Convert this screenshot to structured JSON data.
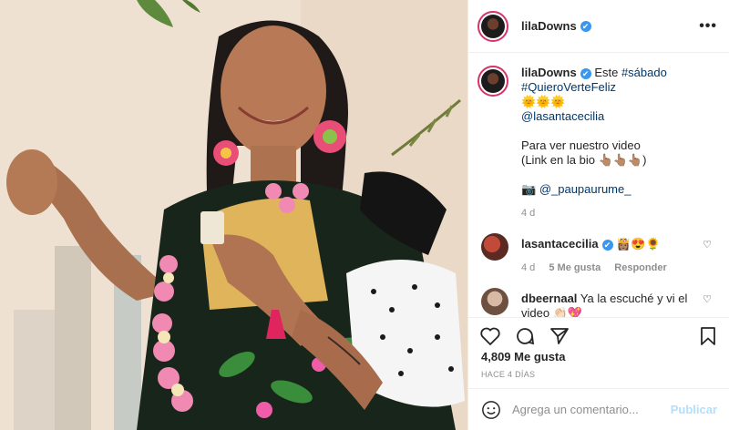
{
  "post": {
    "username": "lilaDowns",
    "verified_mark": "✔",
    "more_icon": "more-icon",
    "caption": {
      "username": "lilaDowns",
      "text_este": "Este",
      "hashtag_sabado": "#sábado",
      "hashtag_quiero": "#QuieroVerteFeliz",
      "suns": "🌞🌞🌞",
      "mention_santa": "@lasantacecilia",
      "line_ver": "Para ver nuestro video",
      "line_link": "(Link en la bio 👆🏽👆🏽👆🏽)",
      "photo_credit_prefix": "📷",
      "photo_credit_handle": "@_paupaurume_",
      "age": "4 d"
    },
    "comments": [
      {
        "username": "lasantacecilia",
        "text": "👸🏽😍🌻",
        "age": "4 d",
        "likes": "5 Me gusta",
        "reply": "Responder"
      },
      {
        "username": "dbeernaal",
        "text": "Ya la escuché y vi el video 👏🏻💖"
      }
    ],
    "likes": "4,809 Me gusta",
    "time_ago": "HACE 4 DÍAS",
    "comment_placeholder": "Agrega un comentario...",
    "publish_label": "Publicar"
  },
  "colors": {
    "accent_link": "#00376b",
    "verified": "#3897f0",
    "publish_disabled": "#b2dffc",
    "muted": "#8e8e8e"
  }
}
